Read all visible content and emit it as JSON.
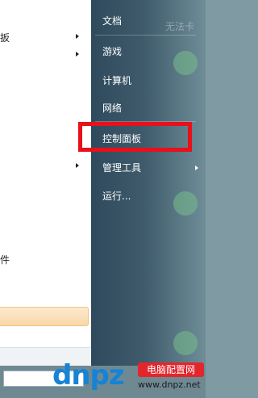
{
  "left_list": {
    "items": [
      {
        "label": "扳",
        "has_arrow": true
      },
      {
        "label": "",
        "has_arrow": true
      },
      {
        "label": "",
        "has_arrow": true
      },
      {
        "label": "件",
        "has_arrow": false
      }
    ]
  },
  "right_menu": {
    "faint_label": "无法卡",
    "items": [
      {
        "label": "文档"
      },
      {
        "label": "游戏"
      },
      {
        "label": "计算机"
      },
      {
        "label": "网络"
      },
      {
        "label": "控制面板",
        "highlighted": true
      },
      {
        "label": "管理工具",
        "has_arrow": true
      },
      {
        "label": "运行..."
      }
    ]
  },
  "annotation": {
    "color": "#e8101a"
  },
  "watermark": {
    "brand": "dnpz",
    "badge": "电脑配置网",
    "url": "www.dnpz.net"
  }
}
